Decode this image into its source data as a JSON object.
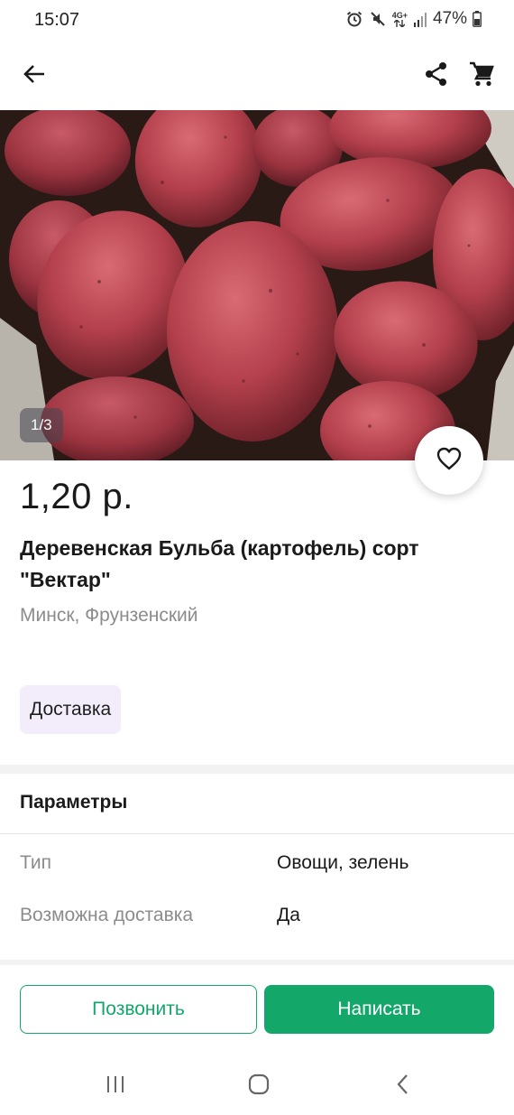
{
  "status_bar": {
    "time": "15:07",
    "network": "4G+",
    "battery": "47%",
    "icons": [
      "alarm-icon",
      "mute-icon",
      "network-4g-icon",
      "signal-icon",
      "battery-icon"
    ]
  },
  "app_bar": {
    "icons": [
      "back-arrow-icon",
      "share-icon",
      "cart-icon"
    ]
  },
  "gallery": {
    "page_indicator": "1/3",
    "image_subject": "red potatoes"
  },
  "listing": {
    "price": "1,20 р.",
    "title": "Деревенская Бульба (картофель) сорт \"Вектар\"",
    "location": "Минск, Фрунзенский",
    "delivery_chip": "Доставка"
  },
  "parameters": {
    "title": "Параметры",
    "rows": [
      {
        "label": "Тип",
        "value": "Овощи, зелень"
      },
      {
        "label": "Возможна доставка",
        "value": "Да"
      }
    ]
  },
  "actions": {
    "call_label": "Позвонить",
    "write_label": "Написать"
  },
  "colors": {
    "accent": "#13a86a",
    "chip_bg": "#f3ecfb",
    "muted_text": "#8c8c8c"
  },
  "nav_bar": {
    "icons": [
      "recents-icon",
      "home-icon",
      "back-icon"
    ]
  }
}
